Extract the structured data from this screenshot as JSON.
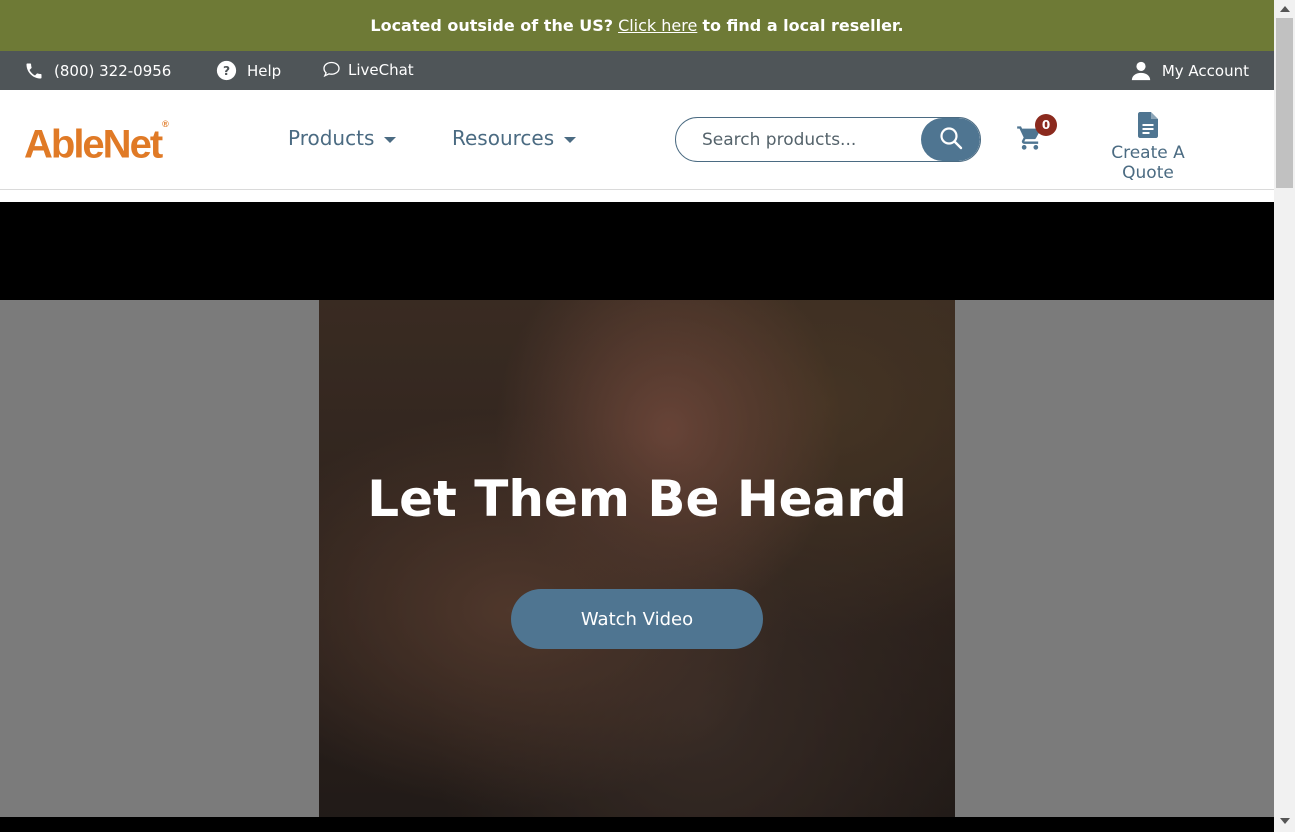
{
  "announcement": {
    "text_before": "Located outside of the US?",
    "link": "Click here",
    "text_after": "to find a local reseller."
  },
  "utility_bar": {
    "phone": "(800) 322-0956",
    "help": "Help",
    "livechat": "LiveChat",
    "account": "My Account"
  },
  "header": {
    "logo": "AbleNet",
    "logo_mark": "®",
    "nav": [
      {
        "label": "Products"
      },
      {
        "label": "Resources"
      }
    ],
    "search": {
      "placeholder": "Search products..."
    },
    "cart_count": "0",
    "quote_label": "Create A Quote"
  },
  "hero": {
    "title": "Let Them Be Heard",
    "button": "Watch Video"
  },
  "colors": {
    "announce_bg": "#6e7a36",
    "utility_bg": "#4f5558",
    "accent": "#4f7591",
    "logo": "#e07a26",
    "badge": "#8b2a1e"
  }
}
